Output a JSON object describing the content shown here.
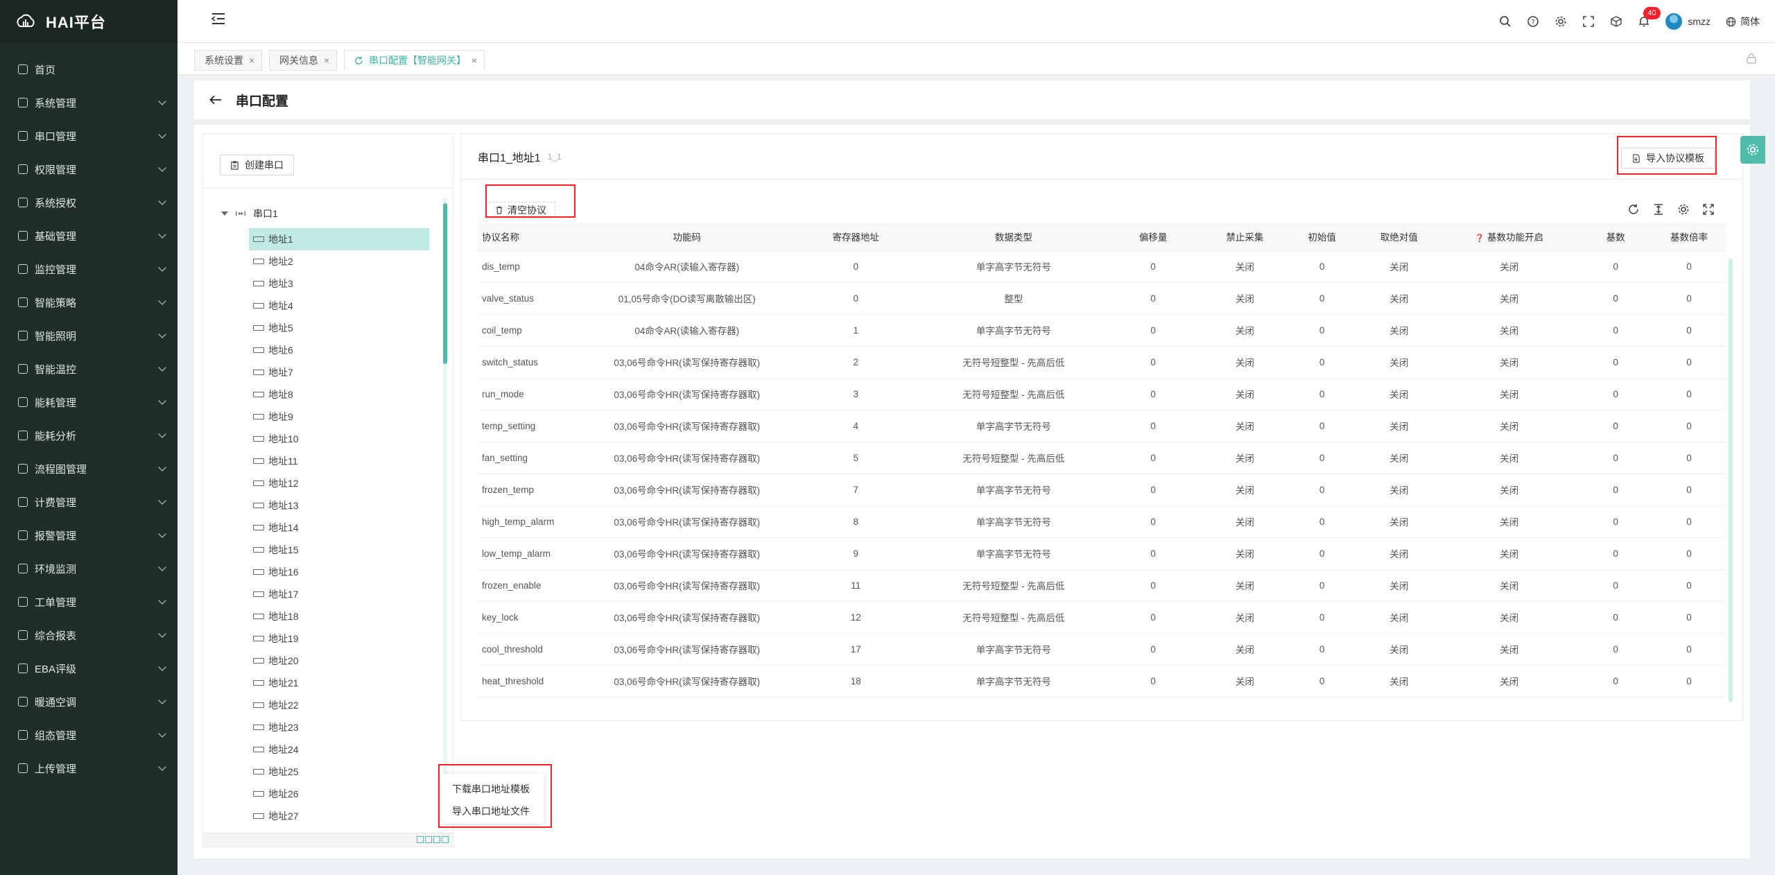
{
  "brand": {
    "name": "HAI平台"
  },
  "sidebar": {
    "items": [
      {
        "label": "首页",
        "icon": "dashboard-icon",
        "expandable": false
      },
      {
        "label": "系统管理",
        "icon": "monitor-icon",
        "expandable": true
      },
      {
        "label": "串口管理",
        "icon": "sliders-icon",
        "expandable": true
      },
      {
        "label": "权限管理",
        "icon": "shield-icon",
        "expandable": true
      },
      {
        "label": "系统授权",
        "icon": "system-icon",
        "expandable": true
      },
      {
        "label": "基础管理",
        "icon": "grid-icon",
        "expandable": true
      },
      {
        "label": "监控管理",
        "icon": "camera-icon",
        "expandable": true
      },
      {
        "label": "智能策略",
        "icon": "bulb-icon",
        "expandable": true
      },
      {
        "label": "智能照明",
        "icon": "light-icon",
        "expandable": true
      },
      {
        "label": "智能温控",
        "icon": "thermo-icon",
        "expandable": true
      },
      {
        "label": "能耗管理",
        "icon": "sliders-icon",
        "expandable": true
      },
      {
        "label": "能耗分析",
        "icon": "bar-chart-icon",
        "expandable": true
      },
      {
        "label": "流程图管理",
        "icon": "flow-icon",
        "expandable": true
      },
      {
        "label": "计费管理",
        "icon": "billing-icon",
        "expandable": true
      },
      {
        "label": "报警管理",
        "icon": "alarm-icon",
        "expandable": true
      },
      {
        "label": "环境监测",
        "icon": "env-icon",
        "expandable": true
      },
      {
        "label": "工单管理",
        "icon": "ticket-icon",
        "expandable": true
      },
      {
        "label": "综合报表",
        "icon": "report-icon",
        "expandable": true
      },
      {
        "label": "EBA评级",
        "icon": "rating-icon",
        "expandable": true
      },
      {
        "label": "暖通空调",
        "icon": "hvac-icon",
        "expandable": true
      },
      {
        "label": "组态管理",
        "icon": "config-icon",
        "expandable": true
      },
      {
        "label": "上传管理",
        "icon": "upload-icon",
        "expandable": true
      }
    ]
  },
  "header": {
    "notification_count": "40",
    "username": "smzz",
    "language": "简体"
  },
  "tabs": [
    {
      "label": "系统设置",
      "active": false
    },
    {
      "label": "网关信息",
      "active": false
    },
    {
      "label": "串口配置【智能网关】",
      "active": true
    }
  ],
  "page": {
    "title": "串口配置"
  },
  "tree": {
    "create_label": "创建串口",
    "root_label": "串口1",
    "nodes": [
      "地址1",
      "地址2",
      "地址3",
      "地址4",
      "地址5",
      "地址6",
      "地址7",
      "地址8",
      "地址9",
      "地址10",
      "地址11",
      "地址12",
      "地址13",
      "地址14",
      "地址15",
      "地址16",
      "地址17",
      "地址18",
      "地址19",
      "地址20",
      "地址21",
      "地址22",
      "地址23",
      "地址24",
      "地址25",
      "地址26",
      "地址27"
    ],
    "selected_index": 0
  },
  "context_menu": {
    "items": [
      "下载串口地址模板",
      "导入串口地址文件"
    ]
  },
  "protocol": {
    "title": "串口1_地址1",
    "subtitle": "1_1",
    "import_label": "导入协议模板",
    "clear_label": "清空协议",
    "columns": [
      "协议名称",
      "功能码",
      "寄存器地址",
      "数据类型",
      "偏移量",
      "禁止采集",
      "初始值",
      "取绝对值",
      "基数功能开启",
      "基数",
      "基数倍率"
    ],
    "rows": [
      [
        "dis_temp",
        "04命令AR(读输入寄存器)",
        "0",
        "单字高字节无符号",
        "0",
        "关闭",
        "0",
        "关闭",
        "关闭",
        "0",
        "0"
      ],
      [
        "valve_status",
        "01,05号命令(DO读写离散输出区)",
        "0",
        "整型",
        "0",
        "关闭",
        "0",
        "关闭",
        "关闭",
        "0",
        "0"
      ],
      [
        "coil_temp",
        "04命令AR(读输入寄存器)",
        "1",
        "单字高字节无符号",
        "0",
        "关闭",
        "0",
        "关闭",
        "关闭",
        "0",
        "0"
      ],
      [
        "switch_status",
        "03,06号命令HR(读写保持寄存器取)",
        "2",
        "无符号短整型 - 先高后低",
        "0",
        "关闭",
        "0",
        "关闭",
        "关闭",
        "0",
        "0"
      ],
      [
        "run_mode",
        "03,06号命令HR(读写保持寄存器取)",
        "3",
        "无符号短整型 - 先高后低",
        "0",
        "关闭",
        "0",
        "关闭",
        "关闭",
        "0",
        "0"
      ],
      [
        "temp_setting",
        "03,06号命令HR(读写保持寄存器取)",
        "4",
        "单字高字节无符号",
        "0",
        "关闭",
        "0",
        "关闭",
        "关闭",
        "0",
        "0"
      ],
      [
        "fan_setting",
        "03,06号命令HR(读写保持寄存器取)",
        "5",
        "无符号短整型 - 先高后低",
        "0",
        "关闭",
        "0",
        "关闭",
        "关闭",
        "0",
        "0"
      ],
      [
        "frozen_temp",
        "03,06号命令HR(读写保持寄存器取)",
        "7",
        "单字高字节无符号",
        "0",
        "关闭",
        "0",
        "关闭",
        "关闭",
        "0",
        "0"
      ],
      [
        "high_temp_alarm",
        "03,06号命令HR(读写保持寄存器取)",
        "8",
        "单字高字节无符号",
        "0",
        "关闭",
        "0",
        "关闭",
        "关闭",
        "0",
        "0"
      ],
      [
        "low_temp_alarm",
        "03,06号命令HR(读写保持寄存器取)",
        "9",
        "单字高字节无符号",
        "0",
        "关闭",
        "0",
        "关闭",
        "关闭",
        "0",
        "0"
      ],
      [
        "frozen_enable",
        "03,06号命令HR(读写保持寄存器取)",
        "11",
        "无符号短整型 - 先高后低",
        "0",
        "关闭",
        "0",
        "关闭",
        "关闭",
        "0",
        "0"
      ],
      [
        "key_lock",
        "03,06号命令HR(读写保持寄存器取)",
        "12",
        "无符号短整型 - 先高后低",
        "0",
        "关闭",
        "0",
        "关闭",
        "关闭",
        "0",
        "0"
      ],
      [
        "cool_threshold",
        "03,06号命令HR(读写保持寄存器取)",
        "17",
        "单字高字节无符号",
        "0",
        "关闭",
        "0",
        "关闭",
        "关闭",
        "0",
        "0"
      ],
      [
        "heat_threshold",
        "03,06号命令HR(读写保持寄存器取)",
        "18",
        "单字高字节无符号",
        "0",
        "关闭",
        "0",
        "关闭",
        "关闭",
        "0",
        "0"
      ]
    ]
  },
  "colors": {
    "sidebar_bg": "#1f2d2b",
    "accent": "#4fbcab",
    "highlight_frame": "#ff1f1f",
    "badge": "#f5222d"
  }
}
